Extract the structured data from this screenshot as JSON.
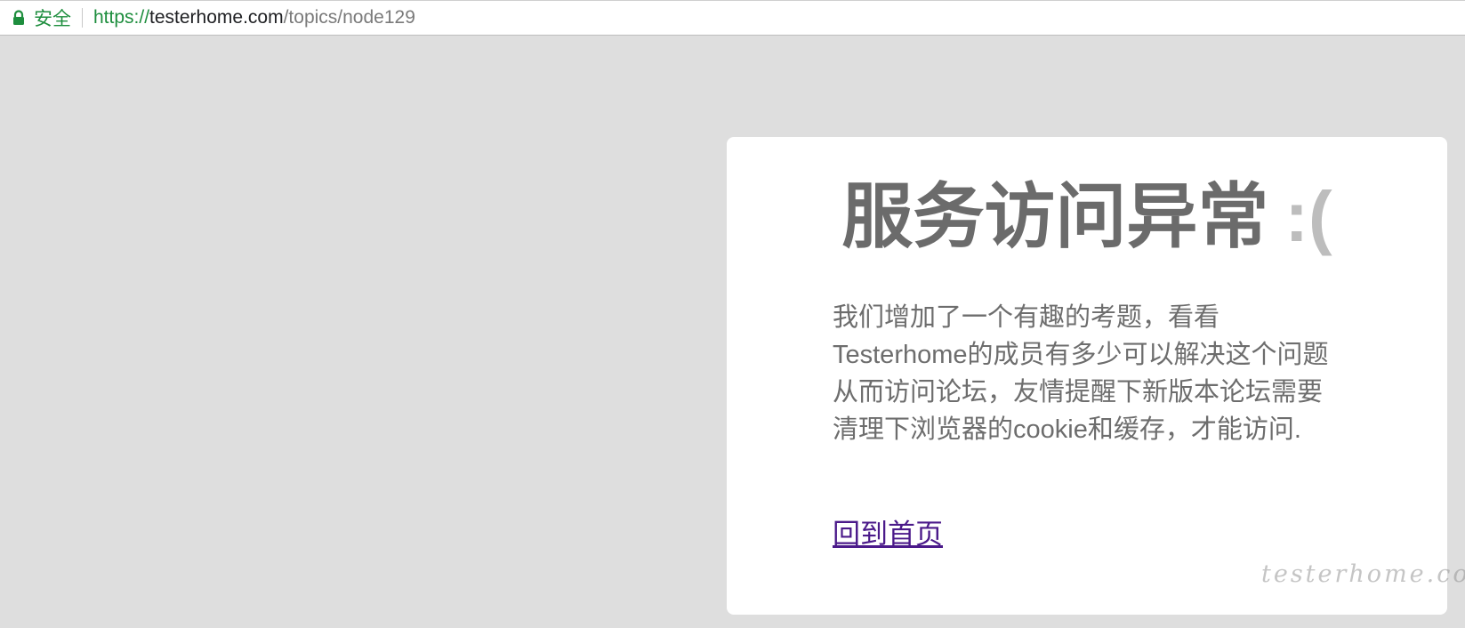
{
  "browser": {
    "secure_label": "安全",
    "url": {
      "scheme": "https://",
      "host": "testerhome.com",
      "path": "/topics/node129"
    }
  },
  "page": {
    "title": "服务访问异常",
    "title_face": ":(",
    "message": "我们增加了一个有趣的考题，看看Testerhome的成员有多少可以解决这个问题从而访问论坛，友情提醒下新版本论坛需要清理下浏览器的cookie和缓存，才能访问.",
    "home_link": "回到首页"
  },
  "watermark": "testerhome.com",
  "colors": {
    "background": "#dedede",
    "secure_green": "#1e8e3e",
    "title": "#6b6b6b",
    "link": "#4b1a8a"
  }
}
